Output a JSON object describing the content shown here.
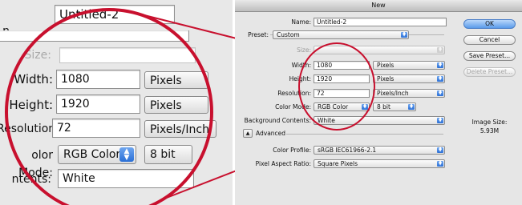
{
  "dialog": {
    "title": "New",
    "name": {
      "label": "Name:",
      "value": "Untitled-2"
    },
    "preset": {
      "label": "Preset:",
      "value": "Custom"
    },
    "size": {
      "label": "Size:",
      "value": ""
    },
    "width": {
      "label": "Width:",
      "value": "1080",
      "unit": "Pixels"
    },
    "height": {
      "label": "Height:",
      "value": "1920",
      "unit": "Pixels"
    },
    "resolution": {
      "label": "Resolution:",
      "value": "72",
      "unit": "Pixels/Inch"
    },
    "color_mode": {
      "label": "Color Mode:",
      "value": "RGB Color",
      "depth": "8 bit"
    },
    "background": {
      "label": "Background Contents:",
      "value": "White"
    },
    "advanced": {
      "label": "Advanced"
    },
    "color_profile": {
      "label": "Color Profile:",
      "value": "sRGB IEC61966-2.1"
    },
    "pixel_aspect": {
      "label": "Pixel Aspect Ratio:",
      "value": "Square Pixels"
    },
    "buttons": {
      "ok": "OK",
      "cancel": "Cancel",
      "save_preset": "Save Preset...",
      "delete_preset": "Delete Preset..."
    },
    "image_size": {
      "label": "Image Size:",
      "value": "5.93M"
    }
  },
  "zoom": {
    "name_value": "Untitled-2",
    "row2": "n",
    "size_label": "Size:",
    "width_label": "Width:",
    "width_value": "1080",
    "width_unit": "Pixels",
    "height_label": "Height:",
    "height_value": "1920",
    "height_unit": "Pixels",
    "resolution_label": "Resolution:",
    "resolution_value": "72",
    "resolution_unit": "Pixels/Inch",
    "color_mode_label": "olor Mode:",
    "color_mode_value": "RGB Color",
    "color_mode_depth": "8 bit",
    "contents_label": "ntents:",
    "contents_value": "White"
  },
  "colors": {
    "callout": "#c8102e",
    "accent": "#2a6fd6"
  }
}
